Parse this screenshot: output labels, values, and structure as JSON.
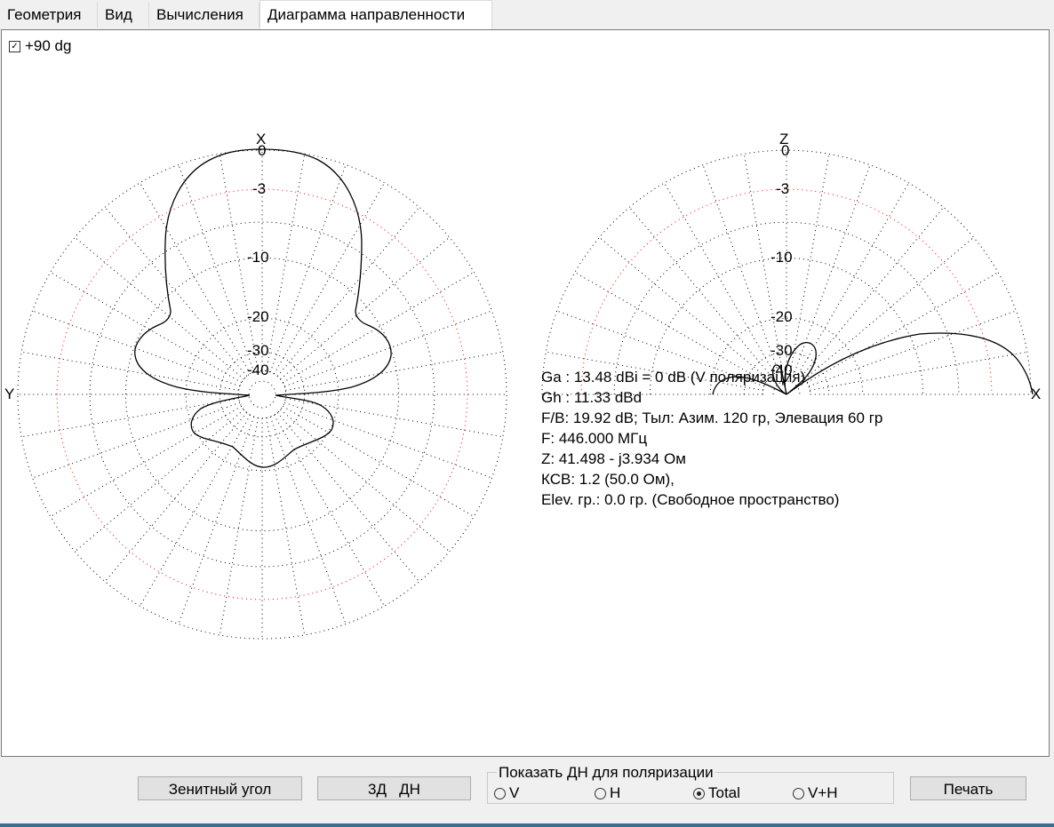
{
  "tabs": [
    {
      "label": "Геометрия"
    },
    {
      "label": "Вид"
    },
    {
      "label": "Вычисления"
    },
    {
      "label": "Диаграмма направленности"
    }
  ],
  "checkbox": {
    "label": "+90 dg",
    "checked": true
  },
  "colors": {
    "grid": "#000000",
    "ref_circle": "#ff0000",
    "curve": "#000000"
  },
  "chart_data": [
    {
      "type": "polar",
      "axis_top": "X",
      "axis_left": "Y",
      "ring_labels": [
        "0",
        "-3",
        "-10",
        "-20",
        "-30",
        "-40"
      ],
      "ring_db": [
        0,
        -3,
        -10,
        -20,
        -30,
        -40
      ],
      "radial_lines_every_deg": 10,
      "pattern": "full",
      "max_direction": "X"
    },
    {
      "type": "polar",
      "axis_top": "Z",
      "axis_right": "X",
      "ring_labels": [
        "0",
        "-3",
        "-10",
        "-20",
        "-30",
        "-40"
      ],
      "ring_db": [
        0,
        -3,
        -10,
        -20,
        -30,
        -40
      ],
      "radial_lines_every_deg": 10,
      "pattern": "upper-half",
      "max_direction": "X"
    }
  ],
  "info": {
    "ga": "Ga : 13.48 dBi = 0 dB  (V поляризация)",
    "gh": "Gh : 11.33 dBd",
    "fb": "F/B: 19.92 dB; Тыл: Азим. 120 гр, Элевация 60 гр",
    "freq": "F: 446.000 МГц",
    "z": "Z: 41.498 - j3.934 Ом",
    "swr": "КСВ: 1.2 (50.0 Ом),",
    "elev": "Elev. гр.: 0.0 гр. (Свободное пространство)"
  },
  "buttons": {
    "zenith": "Зенитный угол",
    "pattern3d": "3Д   ДН",
    "print": "Печать"
  },
  "polarization": {
    "label": "Показать ДН для поляризации",
    "options": [
      {
        "label": "V",
        "selected": false
      },
      {
        "label": "H",
        "selected": false
      },
      {
        "label": "Total",
        "selected": true
      },
      {
        "label": "V+H",
        "selected": false
      }
    ]
  }
}
